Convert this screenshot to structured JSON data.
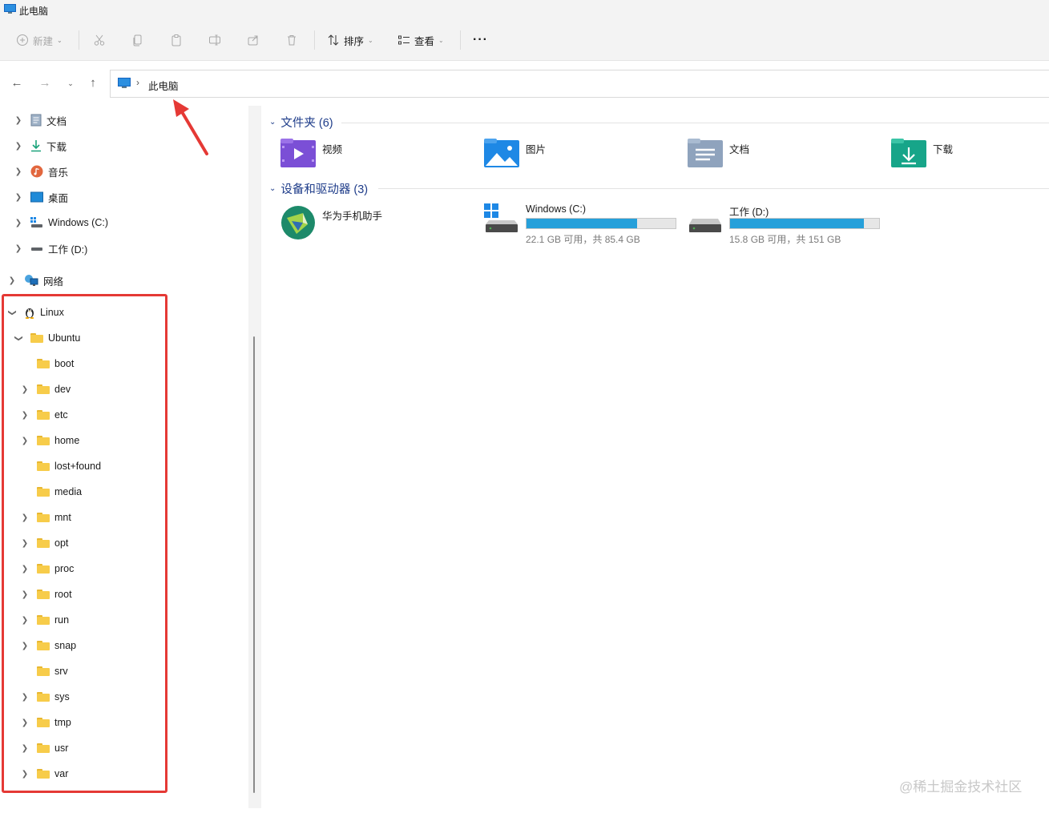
{
  "window": {
    "title": "此电脑"
  },
  "toolbar": {
    "new_label": "新建",
    "sort_label": "排序",
    "view_label": "查看",
    "more_label": "···"
  },
  "address": {
    "segments": [
      "此电脑"
    ]
  },
  "sidebar": {
    "quick_items": [
      {
        "label": "文档",
        "icon": "document-icon"
      },
      {
        "label": "下载",
        "icon": "download-icon"
      },
      {
        "label": "音乐",
        "icon": "music-icon"
      },
      {
        "label": "桌面",
        "icon": "desktop-icon"
      },
      {
        "label": "Windows (C:)",
        "icon": "windows-drive-icon"
      },
      {
        "label": "工作 (D:)",
        "icon": "drive-icon"
      }
    ],
    "network": {
      "label": "网络"
    },
    "linux": {
      "label": "Linux"
    },
    "ubuntu": {
      "label": "Ubuntu"
    },
    "folders": [
      {
        "label": "boot",
        "expandable": false
      },
      {
        "label": "dev",
        "expandable": true
      },
      {
        "label": "etc",
        "expandable": true
      },
      {
        "label": "home",
        "expandable": true
      },
      {
        "label": "lost+found",
        "expandable": false
      },
      {
        "label": "media",
        "expandable": false
      },
      {
        "label": "mnt",
        "expandable": true
      },
      {
        "label": "opt",
        "expandable": true
      },
      {
        "label": "proc",
        "expandable": true
      },
      {
        "label": "root",
        "expandable": true
      },
      {
        "label": "run",
        "expandable": true
      },
      {
        "label": "snap",
        "expandable": true
      },
      {
        "label": "srv",
        "expandable": false
      },
      {
        "label": "sys",
        "expandable": true
      },
      {
        "label": "tmp",
        "expandable": true
      },
      {
        "label": "usr",
        "expandable": true
      },
      {
        "label": "var",
        "expandable": true
      }
    ]
  },
  "main": {
    "folders_header": "文件夹 (6)",
    "folders": [
      {
        "label": "视频",
        "icon": "videos-folder-icon",
        "color": "#7b4fd6"
      },
      {
        "label": "图片",
        "icon": "pictures-folder-icon",
        "color": "#1e88e5"
      },
      {
        "label": "文档",
        "icon": "documents-folder-icon",
        "color": "#8fa3bd"
      },
      {
        "label": "下载",
        "icon": "downloads-folder-icon",
        "color": "#17a589"
      }
    ],
    "devices_header": "设备和驱动器 (3)",
    "devices": [
      {
        "label": "华为手机助手",
        "icon": "huawei-assistant-icon"
      },
      {
        "label": "Windows (C:)",
        "icon": "windows-drive-icon",
        "used_fraction": 0.74,
        "caption": "22.1 GB 可用，共 85.4 GB"
      },
      {
        "label": "工作 (D:)",
        "icon": "drive-icon",
        "used_fraction": 0.9,
        "caption": "15.8 GB 可用，共 151 GB"
      }
    ]
  },
  "colors": {
    "accent": "#26a0da",
    "highlight": "#e53935",
    "section_header": "#1f3d8a"
  },
  "watermark": "@稀土掘金技术社区"
}
